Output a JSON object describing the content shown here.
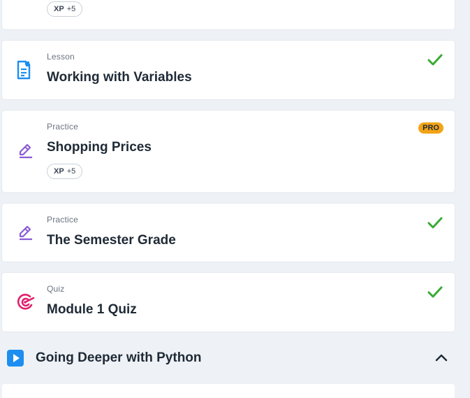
{
  "top_card": {
    "xp_label": "XP",
    "xp_value": "+5"
  },
  "items": [
    {
      "kind": "Lesson",
      "title": "Working with Variables",
      "icon": "document-icon",
      "status": "completed"
    },
    {
      "kind": "Practice",
      "title": "Shopping Prices",
      "icon": "pencil-icon",
      "badge": "PRO",
      "xp_label": "XP",
      "xp_value": "+5"
    },
    {
      "kind": "Practice",
      "title": "The Semester Grade",
      "icon": "pencil-icon",
      "status": "completed"
    },
    {
      "kind": "Quiz",
      "title": "Module 1 Quiz",
      "icon": "target-icon",
      "status": "completed"
    }
  ],
  "section": {
    "title": "Going Deeper with Python",
    "icon": "play-icon",
    "toggle_icon": "chevron-up-icon"
  },
  "colors": {
    "background": "#eef2f6",
    "check": "#3aaa35",
    "pro_badge": "#f2a417",
    "lesson_icon": "#1d8ef0",
    "practice_icon": "#8a5cd6",
    "quiz_icon": "#e0206c",
    "section_icon": "#1d8ef0"
  }
}
